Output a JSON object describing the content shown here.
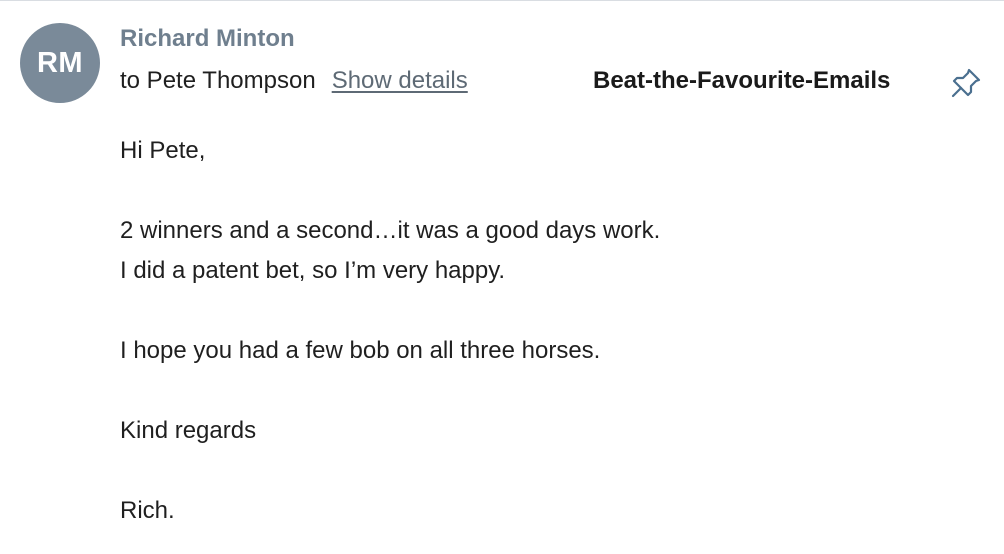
{
  "sender": {
    "initials": "RM",
    "name": "Richard Minton"
  },
  "recipient": {
    "text": "to Pete Thompson",
    "show_details_label": "Show details"
  },
  "folder": {
    "label": "Beat-the-Favourite-Emails"
  },
  "icons": {
    "pin": "pin-icon"
  },
  "colors": {
    "avatar_bg": "#7a8a99",
    "sender_name": "#6f7f8e",
    "pin": "#4a6f8f"
  },
  "body": {
    "lines": [
      "Hi Pete,",
      "",
      "2 winners and a second…it was a good days work.",
      "I did a patent bet, so I’m very happy.",
      "",
      "I hope you had a few bob on all three horses.",
      "",
      "Kind regards",
      "",
      "Rich."
    ]
  }
}
